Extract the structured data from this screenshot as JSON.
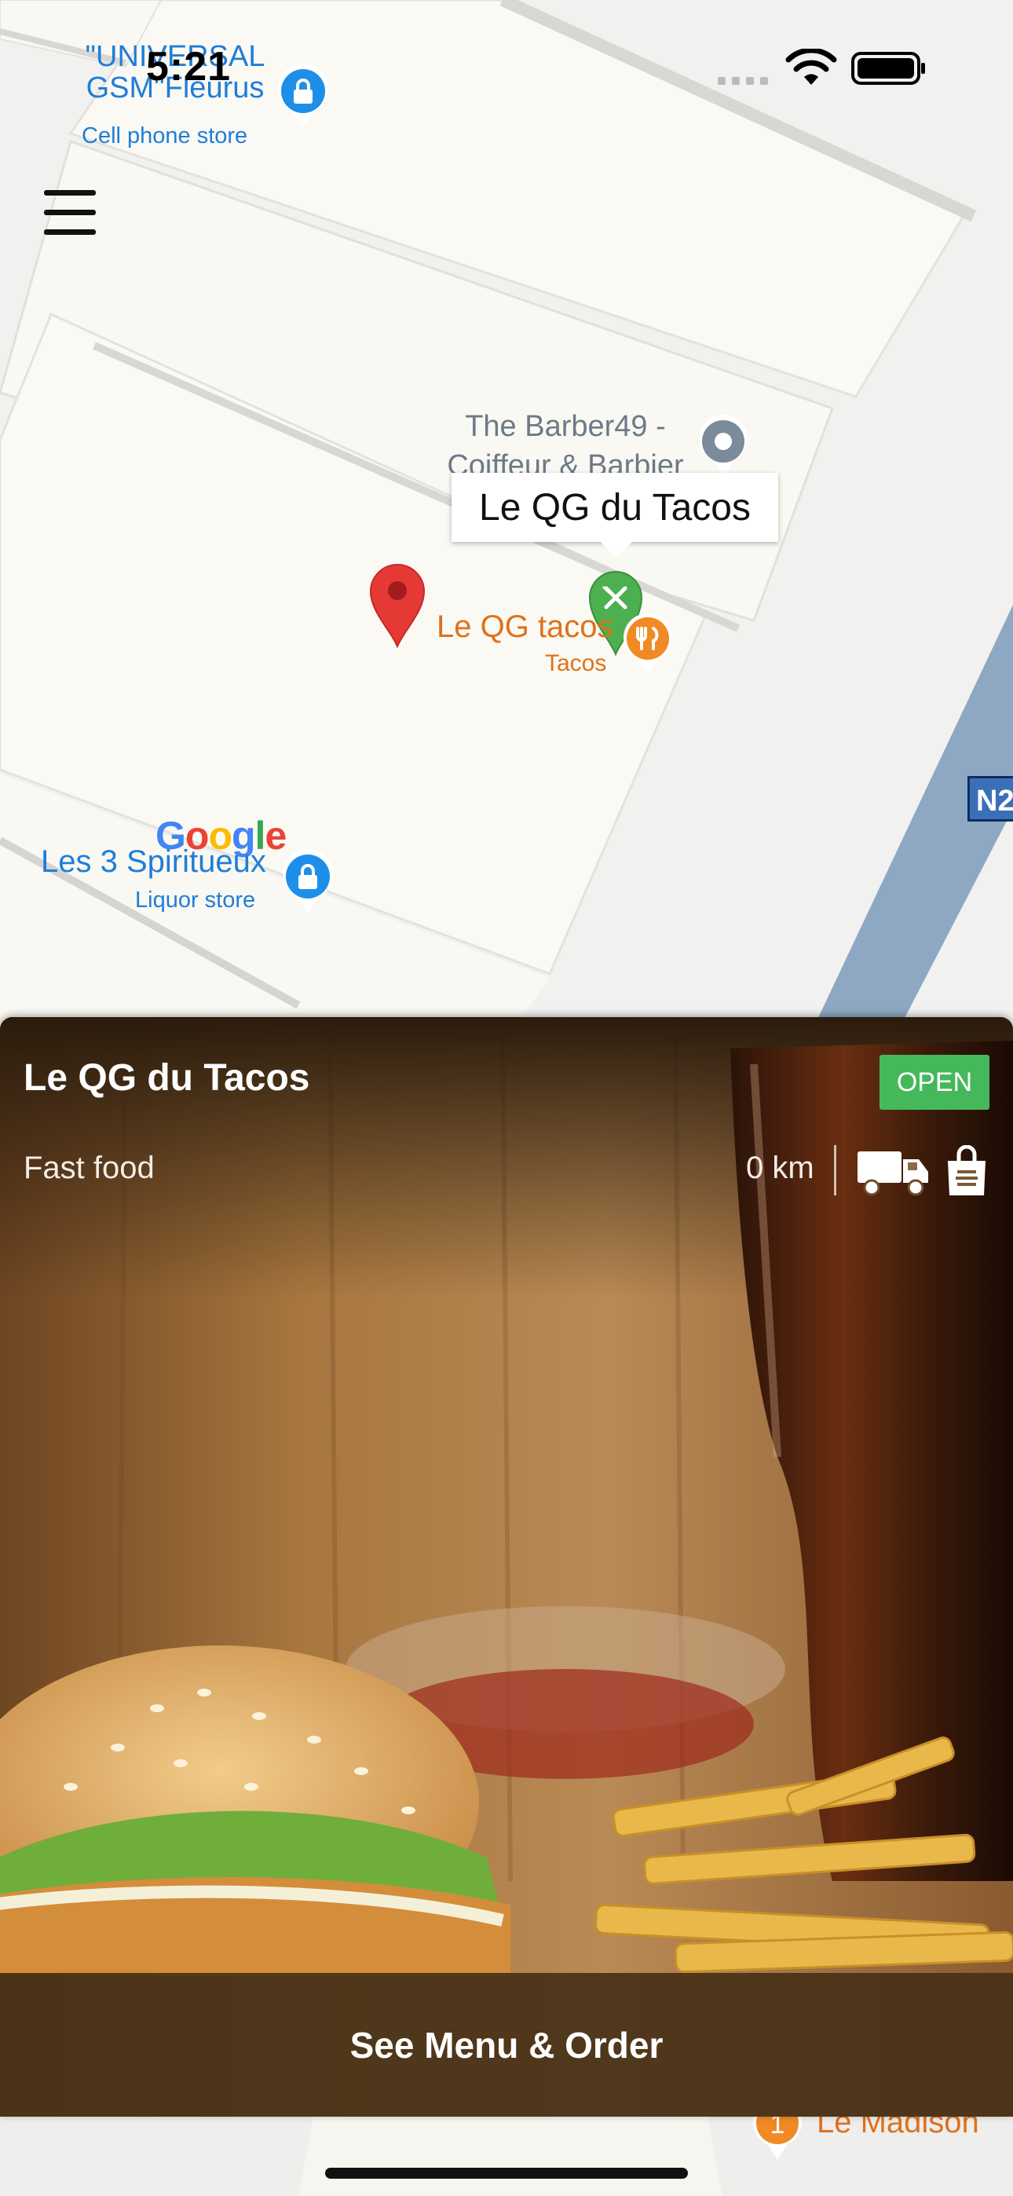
{
  "status_bar": {
    "time": "5:21"
  },
  "map": {
    "poi_gsm": {
      "name_line1": "\"UNIVERSAL",
      "name_line2": "GSM\"Fleurus",
      "category": "Cell phone store"
    },
    "poi_barber": {
      "name_line1": "The Barber49 -",
      "name_line2": "Coiffeur & Barbier"
    },
    "poi_tacos": {
      "name": "Le QG tacos",
      "category": "Tacos"
    },
    "poi_spiritueux": {
      "name": "Les 3 Spiritueux",
      "category": "Liquor store"
    },
    "poi_madison": {
      "name": "Le Madison"
    },
    "road_shield": "N2",
    "google_logo": "Google",
    "callout": "Le QG du Tacos",
    "colors": {
      "poi_blue": "#1e7ed9",
      "pin_red": "#e53935",
      "pin_green": "#4caf50",
      "food_orange": "#f08a24",
      "road_blue": "#8ea8c3"
    }
  },
  "card": {
    "title": "Le QG du Tacos",
    "category": "Fast food",
    "status_badge": "OPEN",
    "distance": "0 km",
    "icons": [
      "delivery-truck-icon",
      "takeaway-bag-icon"
    ],
    "cta": "See Menu & Order",
    "colors": {
      "open_green": "#45b85b",
      "cta_bg": "#483218"
    }
  }
}
